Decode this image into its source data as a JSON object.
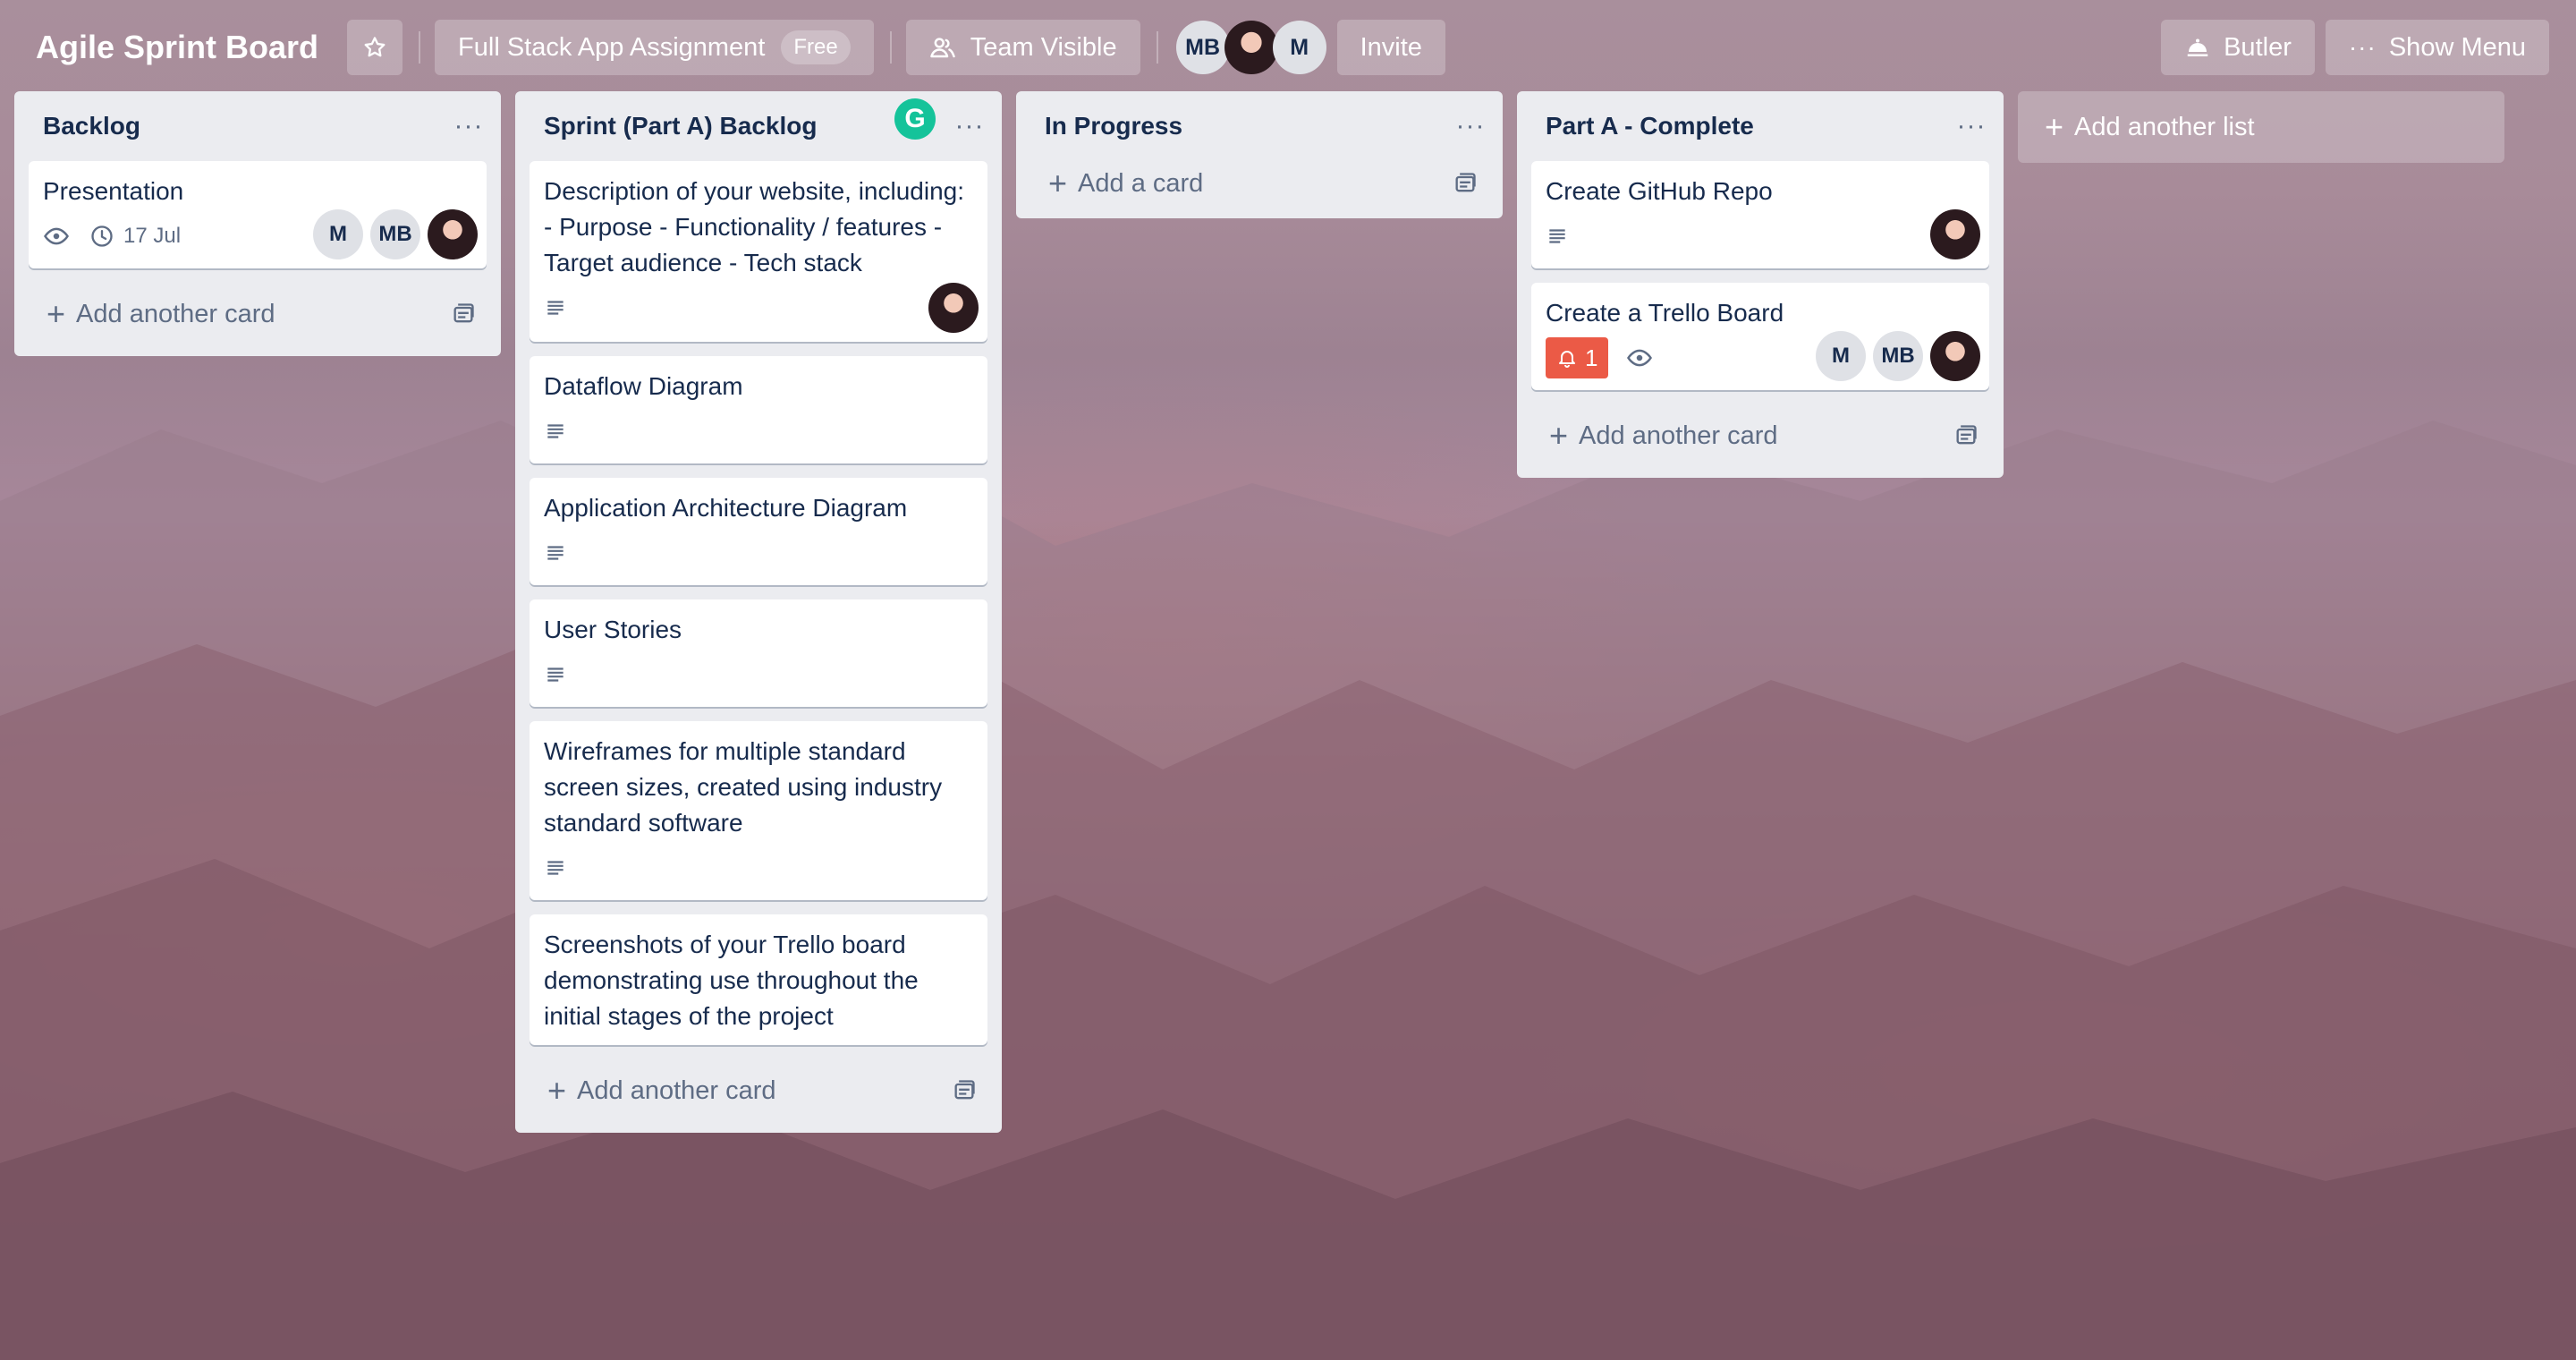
{
  "header": {
    "board_title": "Agile Sprint Board",
    "workspace_name": "Full Stack App Assignment",
    "workspace_badge": "Free",
    "visibility": "Team Visible",
    "members": [
      "MB",
      "",
      "M"
    ],
    "invite": "Invite",
    "butler": "Butler",
    "show_menu": "Show Menu"
  },
  "lists": [
    {
      "title": "Backlog",
      "menu": "···",
      "cards": [
        {
          "title": "Presentation",
          "due": "17 Jul",
          "members": [
            "M",
            "MB",
            ""
          ]
        }
      ],
      "add_label": "Add another card"
    },
    {
      "title": "Sprint (Part A) Backlog",
      "menu": "···",
      "cards": [
        {
          "title": "Description of your website, including: - Purpose - Functionality / features - Target audience - Tech stack"
        },
        {
          "title": "Dataflow Diagram"
        },
        {
          "title": "Application Architecture Diagram"
        },
        {
          "title": "User Stories"
        },
        {
          "title": "Wireframes for multiple standard screen sizes, created using industry standard software"
        },
        {
          "title": "Screenshots of your Trello board demonstrating use throughout the initial stages of the project"
        }
      ],
      "add_label": "Add another card"
    },
    {
      "title": "In Progress",
      "menu": "···",
      "cards": [],
      "add_label": "Add a card"
    },
    {
      "title": "Part A - Complete",
      "menu": "···",
      "cards": [
        {
          "title": "Create GitHub Repo"
        },
        {
          "title": "Create a Trello Board",
          "notifications": "1",
          "members": [
            "M",
            "MB",
            ""
          ]
        }
      ],
      "add_label": "Add another card"
    }
  ],
  "add_list_label": "Add another list",
  "colors": {
    "list_bg": "#ebecf0",
    "text": "#172b4d",
    "muted": "#5e6c84",
    "notification": "#eb5a46",
    "grammarly": "#15c39a"
  }
}
